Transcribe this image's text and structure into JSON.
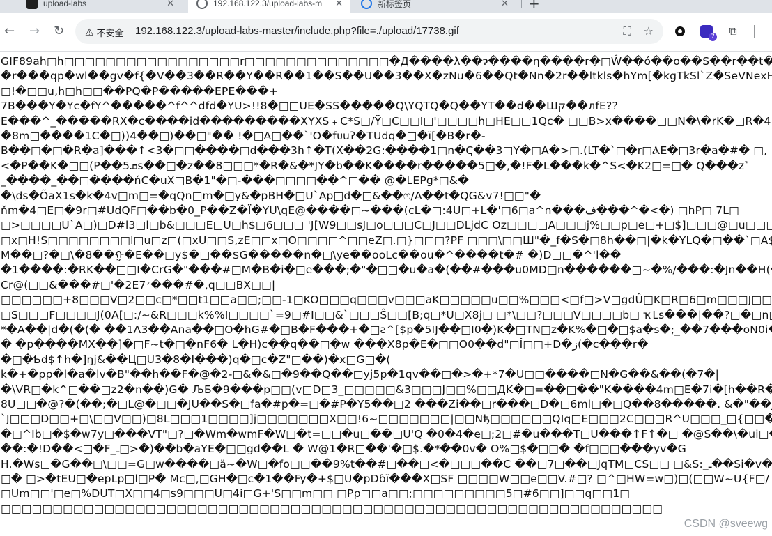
{
  "browser": {
    "tabs": [
      {
        "title": "upload-labs",
        "active": false,
        "favicon": "upload-labs-icon"
      },
      {
        "title": "192.168.122.3/upload-labs-m",
        "active": true,
        "favicon": "globe-icon"
      },
      {
        "title": "新标签页",
        "active": false,
        "favicon": "new-tab-icon"
      }
    ],
    "tab_close_glyph": "✕",
    "new_tab_glyph": "+",
    "nav": {
      "back": "←",
      "forward": "→",
      "reload": "↻"
    },
    "security_label": "不安全",
    "security_icon": "warning-triangle-icon",
    "url": "192.168.122.3/upload-labs-master/include.php?file=./upload/17738.gif",
    "extension_badge": "7"
  },
  "page": {
    "lines": [
      "GIF89ah□h□□□□□□□□□□□□□□□□□r□□□□□□□□□□□□□□�Д����λ��ɂ����η����r�□Ŵ��ó��o��S��r��t��wúP��m�r��T�",
      "�r���qp�wl��gv�f{�V��3��R��Y��R��1��S��U��3��X�zNu�6��Qt�Nn�2r��ltkls�hYm[�kgTkSl`Z�SeVNexH[",
      "□!�□□u,h□h□□��PQ�P�����EPE���+",
      "7B���Y�Yc�fY^�����^f^^dfd�YU>!!8�□□UE�SS�����Q\\YQTQ�Q��YT��d��Шק��лfE??",
      "E���^_�����RX�c����id���������XYXS﹢C*S□/Ÿ□C□□I□'□□□□h□HE□□1Qc� □□B>x����□□N�\\�rK�□R�4",
      "�8m□����1C�□))4��□)��□\"�� !�□A□��`'O�fᴜuʔ�TUdq�□�ï[�B�r�-",
      "B��□�□�R�a]���↑<3�□□����□d���3h↑�T(X��2G:����1□n�Ҁ��3□Y�□A�>□.(LT�`□�r□ⲀE�□3r�a�#� □,",
      "<�P��K�□□(P��ܩ5s��□�z��8□□□*�R�&�*JY�b��K����r�����5□�,�!F�L���k�^S<�K2□=□� Q���z˺",
      "_����_��□����ńC�uX□B�1\"�□-���□□□□��^□�� @�LEPg*□&�",
      "�\\ds�ÕaX1s�k�4v□m□=�qQn□m�□y&�pBH�□U`Ap□d�□&��ෆ/A��t�QG&v7!□□\"�",
      "ňm�4□E□�9r□#UdQF□��b�0_P��Z�Ï�YU\\qE@����□~���(cL�□:4U□+L�'□6□a^n���ف���^�<�) □hP□ 7L□",
      "□>□□□□U`A□)□D#l3□l□b&□□□E□U□h$□6□□□ 'J[W9□□sJ□o□□□C□J□□DLjdC Oz□□□□A□□□j%□□p□e□+□$]□□□@□u□□□□vP□□□□□!I□",
      "□x□H!S□□□□□□□□l□u□z□(□xU□□S,zE□□x□O□□□□^□□eZ□.□}□□□?PF □□□\\□□Ш\"�_f�S�□8h��□|�k�YLQ�□��`□A$���>=�□□���□a",
      "M��□?�□\\�8��ᠭ�E��□y$�□��$G�����n�□\\ye��ooLc��ou�^����t�# �)D□□�^'l��",
      "�1����:�RK��□□I�CrG�\"���#□M�B�i�□e���;�\"�□□�u�a�(��#���u0MD□n������□~�%/���:�Jn��H(���□",
      "Cr@(□□&���#□'�2E׳7���#�,q□□BX□□|",
      "□□□□□□+8□□□V□2□□c□*□□t1□□a□□;□□-1□KO□□□q□□□v□□□aK□□□□□u□□%□□□<□f□>V□gdÛ□K□R□6□m□□□J□□1□□n□o□□□□□0□9□.□C2",
      "□S□□□F□□□□J(0A[□:/~&R□□□k%%I□□□□`=9□#I□□&`□□□Ŝ□□[B;q□*U□X8j□ □*\\□□?□□□V□□□□b□ ҡLs���|��?□�□n□S�>�i",
      "*�A��|d�(�(� ��1Λ3��Ana��□O�hG#�□B�F���+�□ƨ^[$p�5IJ��□I0�)K�□TN□z�K%�□�□$a�s�;_��7���oN0i�□�`�",
      "� �p����MX��]�□F~t�□�nF6� L�H)c��q��□�w ���X8p�E�□□O0��d\"□Î□□+D�ز(�c���r�",
      "�□�Ƅd$↑h�]ŋj&��Ц□U3�8�I���)q�□c�Z\"□��)�x□G□�(",
      "k�+�pp�l�a�lv�B\"��h��F�@�2-□&�&□�9��Q��□yj5p�1qv��□�>�+*7�U□□����□N�G��&��(�7�|",
      "�\\VR□�k^□��□z2�n��)G� ЉБ�9���p□□(v□D□3_□□□□□&3□□□J□□%□□ДK�□=��□��\"K����4m□E�7i�[h��R����m□��",
      "8U□□�@?�(��;�□L@�□□�JU��S�□fa�#p�=□�#P�Y5��□2 ���Zi��□r���□D�□6ml□�□Q��8�����. &�\"��jflO�L�",
      "`J□□□D□□+□\\□□V□□)□8L□□□1□□□□]j□□□□□□□X□□!6~□□□□□□□|□□Nђ□□□□□□QIq□E□□□2C□□□R^U□□□_□{□□����GɵrX�?r�U��?",
      "�□^Ib□�$�w7y□���VT\"□?□�Wm�wmF�W□�t=□□�u□��□U'Q �0�4�e□;2□#�u���T□U���↑F↑�□ �@S��\\�ui□�}",
      "��:�!D��<□�F_ـ□>�)��b�aYE�□□gd��L � W@1�R□��'�□$.�*��0v� O%□$�□□� �f□□□���yv�G",
      "H.�Ws□�G��□\\□□=G□w����□ä~�W□�fo□□��9%t��#□��□<�□□□��C ��□7□��□JqTM□CS□□ □&S:_ـ��Si�v��a�@□",
      "□� □>�tEU□�epLp□l□P� Mc□,□GH�□c�1��Fy�+$□U�pDɓï���X□SF □□□□W□□e□□V.#□? □^□HW=w□)□(□□W~U{F□/",
      "□Um□□'□e□%DUT□X□□4□s9□□□U□4i□G+'S□□m□□ □Pp□□a□□;□□□□□□□□□5□#6□□]□□q□□1□",
      "□□□□□□□□□□□□□□□□□□□□□□□□□□□□□□□□□□□□□□□□□□□□□□□□□□□□□□□□□□□□□□□□"
    ]
  },
  "watermark": "CSDN @sveewg"
}
